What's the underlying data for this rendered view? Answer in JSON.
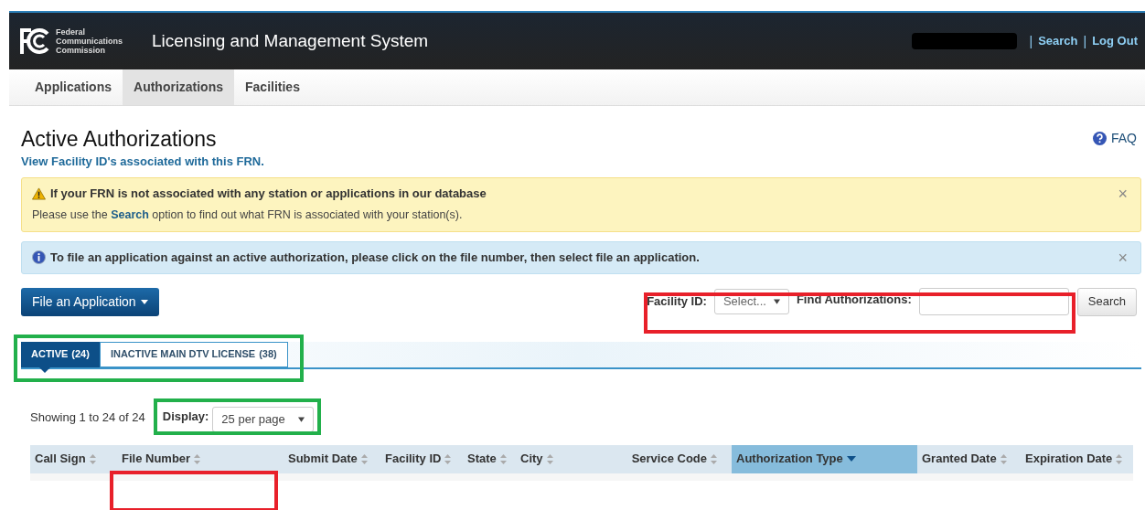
{
  "header": {
    "logo_lines": [
      "Federal",
      "Communications",
      "Commission"
    ],
    "title": "Licensing and Management System",
    "links": [
      "Search",
      "Log Out"
    ],
    "separators": [
      "|",
      "|"
    ]
  },
  "nav": [
    {
      "label": "Applications",
      "selected": false
    },
    {
      "label": "Authorizations",
      "selected": true
    },
    {
      "label": "Facilities",
      "selected": false
    }
  ],
  "page_title": "Active Authorizations",
  "faq": "FAQ",
  "facility_link": "View Facility ID's associated with this FRN.",
  "alerts": [
    {
      "kind": "warning",
      "title": "If your FRN is not associated with any station or applications in our database",
      "text": "Please use the **Search** option to find out what FRN is associated with your station(s).",
      "close": "×"
    },
    {
      "kind": "info",
      "text": "To file an application against an active authorization, please click on the file number, then select file an application.",
      "close": "×"
    }
  ],
  "file_button": "File an Application",
  "filter": {
    "facility_label": "Facility ID:",
    "facility_select": "Select...",
    "find_label": "Find Authorizations:",
    "search_button": "Search"
  },
  "tabs": [
    {
      "label": "ACTIVE",
      "count": "(24)",
      "selected": true
    },
    {
      "label": "INACTIVE MAIN DTV LICENSE",
      "count": "(38)",
      "selected": false
    }
  ],
  "showing": "Showing 1 to 24 of 24",
  "display": {
    "label": "Display:",
    "value": "25 per page"
  },
  "table": {
    "columns": [
      {
        "label": "Call Sign",
        "sorted": false
      },
      {
        "label": "File Number",
        "sorted": false
      },
      {
        "label": "Submit Date",
        "sorted": false
      },
      {
        "label": "Facility ID",
        "sorted": false
      },
      {
        "label": "State",
        "sorted": false
      },
      {
        "label": "City",
        "sorted": false
      },
      {
        "label": "Service Code",
        "sorted": false
      },
      {
        "label": "Authorization Type",
        "sorted": true
      },
      {
        "label": "Granted Date",
        "sorted": false
      },
      {
        "label": "Expiration Date",
        "sorted": false
      }
    ]
  },
  "annotations": [
    {
      "color": "#e8202a"
    },
    {
      "color": "#22b04b"
    },
    {
      "color": "#22b04b"
    },
    {
      "color": "#e8202a"
    }
  ]
}
